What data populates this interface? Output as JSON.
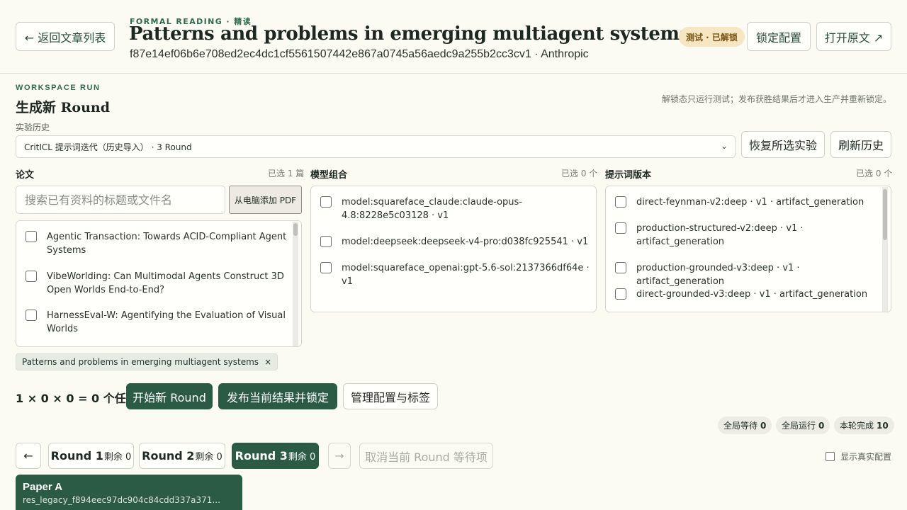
{
  "header": {
    "back_label": "← 返回文章列表",
    "eyebrow": "FORMAL READING · 精读",
    "title": "Patterns and problems in emerging multiagent systems",
    "subtitle": "f87e14ef06b6e708ed2ec4dc1cf5561507442e867a0745a56aedc9a255b2cc3cv1 · Anthropic",
    "badge": "测试 · 已解锁",
    "lock_label": "锁定配置",
    "open_label": "打开原文 ↗"
  },
  "workspace": {
    "eyebrow": "WORKSPACE RUN",
    "title": "生成新 Round",
    "note": "解锁态只运行测试；发布获胜结果后才进入生产并重新锁定。",
    "history_label": "实验历史",
    "history_selected": "CritICL 提示词迭代（历史导入） · 3 Round",
    "restore_label": "恢复所选实验",
    "refresh_label": "刷新历史"
  },
  "papers": {
    "heading": "论文",
    "count": "已选 1 篇",
    "search_placeholder": "搜索已有资料的标题或文件名",
    "add_pdf_label": "从电脑添加 PDF",
    "items": [
      {
        "line1": "Agentic Transaction: Towards ACID-Compliant Agent",
        "line2": "Systems"
      },
      {
        "line1": "VibeWorlding: Can Multimodal Agents Construct 3D",
        "line2": "Open Worlds End-to-End?"
      },
      {
        "line1": "HarnessEval-W: Agentifying the Evaluation of Visual",
        "line2": "Worlds"
      }
    ],
    "selected_chip": "Patterns and problems in emerging multiagent systems",
    "chip_remove": "×"
  },
  "models": {
    "heading": "模型组合",
    "count": "已选 0 个",
    "items": [
      {
        "line1": "model:squareface_claude:claude-opus-",
        "line2": "4.8:8228e5c03128 · v1"
      },
      {
        "line1": "model:deepseek:deepseek-v4-pro:d038fc925541 · v1",
        "line2": ""
      },
      {
        "line1": "model:squareface_openai:gpt-5.6-sol:2137366df64e · v1",
        "line2": ""
      }
    ]
  },
  "prompts": {
    "heading": "提示词版本",
    "count": "已选 0 个",
    "items": [
      {
        "line1": "direct-feynman-v2:deep · v1 · artifact_generation",
        "line2": ""
      },
      {
        "line1": "production-structured-v2:deep · v1 ·",
        "line2": "artifact_generation"
      },
      {
        "line1": "production-grounded-v3:deep · v1 · artifact_generation",
        "line2": ""
      },
      {
        "line1": "direct-grounded-v3:deep · v1 · artifact_generation",
        "line2": ""
      }
    ]
  },
  "actions": {
    "formula": "1 × 0 × 0 = 0 个任务",
    "start_label": "开始新 Round",
    "publish_label": "发布当前结果并锁定",
    "manage_label": "管理配置与标签"
  },
  "stats": [
    {
      "label": "全局等待",
      "value": "0"
    },
    {
      "label": "全局运行",
      "value": "0"
    },
    {
      "label": "本轮完成",
      "value": "10"
    }
  ],
  "rounds": {
    "prev_label": "←",
    "next_label": "→",
    "items": [
      {
        "name": "Round 1",
        "remaining": "剩余 0"
      },
      {
        "name": "Round 2",
        "remaining": "剩余 0"
      },
      {
        "name": "Round 3",
        "remaining": "剩余 0"
      }
    ],
    "cancel_label": "取消当前 Round 等待项",
    "show_real_label": "显示真实配置"
  },
  "paper_card": {
    "title": "Paper A",
    "id": "res_legacy_f894eec97dc904c84cdd337a371..."
  },
  "colors": {
    "accent": "#2b5b45",
    "background": "#fbfaf3",
    "badge_bg": "#f6e6c2"
  }
}
